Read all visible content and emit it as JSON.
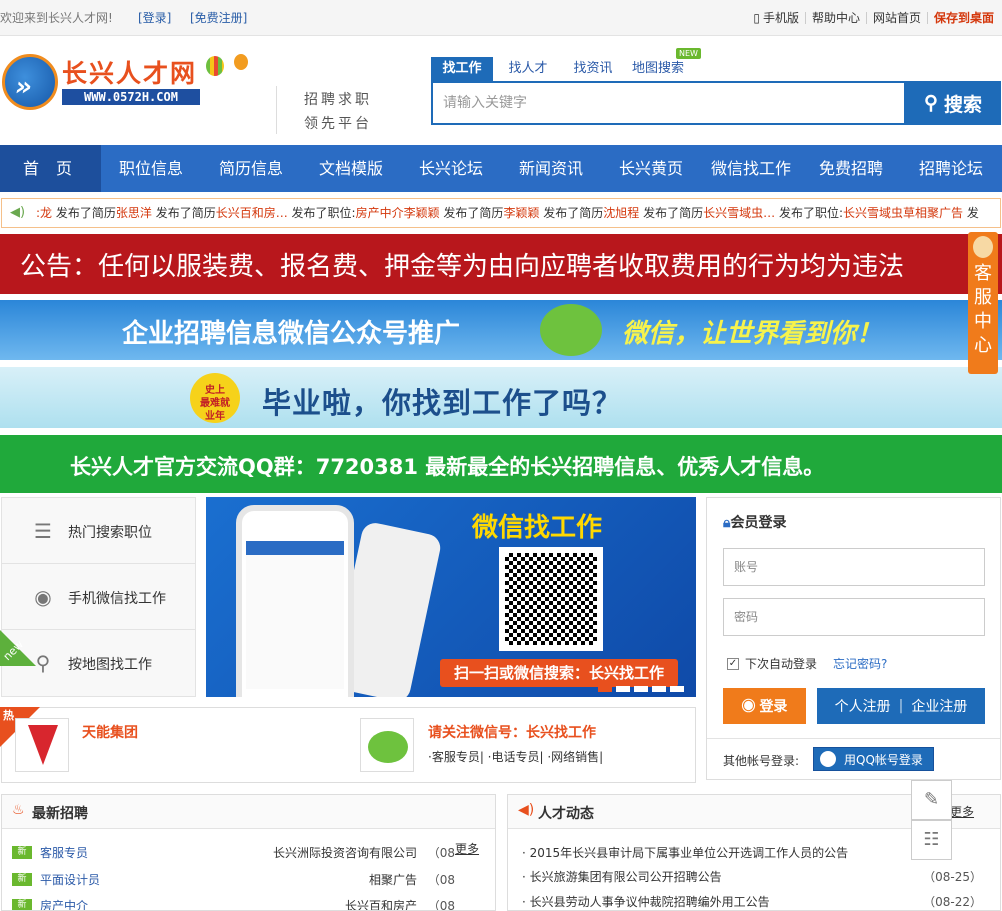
{
  "topbar": {
    "welcome": "欢迎来到长兴人才网!",
    "login": "[登录]",
    "register": "[免费注册]",
    "mobile": "手机版",
    "help": "帮助中心",
    "home": "网站首页",
    "save": "保存到桌面"
  },
  "header": {
    "logo_title": "长兴人才网",
    "logo_url": "WWW.0572H.COM",
    "slogan_line1": "招聘求职",
    "slogan_line2": "领先平台"
  },
  "search": {
    "tabs": [
      "找工作",
      "找人才",
      "找资讯",
      "地图搜索"
    ],
    "new_badge": "NEW",
    "placeholder": "请输入关键字",
    "button": "搜索"
  },
  "nav": [
    "首 页",
    "职位信息",
    "简历信息",
    "文档模版",
    "长兴论坛",
    "新闻资讯",
    "长兴黄页",
    "微信找工作",
    "免费招聘",
    "招聘论坛"
  ],
  "ticker": {
    "segments": [
      {
        "text": ":龙",
        "hl": true
      },
      {
        "text": " 发布了简历",
        "hl": false
      },
      {
        "text": "张思洋",
        "hl": true
      },
      {
        "text": " 发布了简历",
        "hl": false
      },
      {
        "text": "长兴百和房…",
        "hl": true
      },
      {
        "text": " 发布了职位:",
        "hl": false
      },
      {
        "text": "房产中介李颖颖",
        "hl": true
      },
      {
        "text": " 发布了简历",
        "hl": false
      },
      {
        "text": "李颖颖",
        "hl": true
      },
      {
        "text": " 发布了简历",
        "hl": false
      },
      {
        "text": "沈旭程",
        "hl": true
      },
      {
        "text": " 发布了简历",
        "hl": false
      },
      {
        "text": "长兴雪域虫…",
        "hl": true
      },
      {
        "text": " 发布了职位:",
        "hl": false
      },
      {
        "text": "长兴雪域虫草相聚广告",
        "hl": true
      },
      {
        "text": " 发",
        "hl": false
      }
    ]
  },
  "banners": {
    "notice": "公告：任何以服装费、报名费、押金等为由向应聘者收取费用的行为均为违法",
    "wechat_promo": "企业招聘信息微信公众号推广",
    "wechat_slogan": "微信，让世界看到你！",
    "grad_badge_1": "史上",
    "grad_badge_2": "最难就",
    "grad_badge_3": "业年",
    "graduation": "毕业啦，你找到工作了吗？",
    "qq_group": "长兴人才官方交流QQ群：7720381  最新最全的长兴招聘信息、优秀人才信息。"
  },
  "left_menu": [
    {
      "label": "热门搜索职位",
      "icon": "database-search-icon"
    },
    {
      "label": "手机微信找工作",
      "icon": "wechat-icon"
    },
    {
      "label": "按地图找工作",
      "icon": "map-pin-icon"
    }
  ],
  "left_menu_new": "new",
  "promo": {
    "title": "微信找工作",
    "cta": "扫一扫或微信搜索：长兴找工作"
  },
  "login": {
    "title": "会员登录",
    "username_placeholder": "账号",
    "password_placeholder": "密码",
    "auto_login": "下次自动登录",
    "forgot": "忘记密码?",
    "login_btn": "登录",
    "personal_reg": "个人注册",
    "company_reg": "企业注册",
    "other_login": "其他帐号登录:",
    "qq_login": "用QQ帐号登录"
  },
  "hot": {
    "corner": "热",
    "company": "天能集团",
    "wechat_title": "请关注微信号：长兴找工作",
    "wechat_links": "·客服专员| ·电话专员| ·网络销售|"
  },
  "recruit": {
    "title": "最新招聘",
    "more": "更多",
    "rows": [
      {
        "tag": "新",
        "position": "客服专员",
        "company": "长兴洲际投资咨询有限公司",
        "date": "（08"
      },
      {
        "tag": "新",
        "position": "平面设计员",
        "company": "相聚广告",
        "date": "（08"
      },
      {
        "tag": "新",
        "position": "房产中介",
        "company": "长兴百和房产",
        "date": "（08"
      }
    ]
  },
  "news": {
    "title": "人才动态",
    "more": "更多",
    "rows": [
      {
        "title": "· 2015年长兴县审计局下属事业单位公开选调工作人员的公告",
        "date": ""
      },
      {
        "title": "· 长兴旅游集团有限公司公开招聘公告",
        "date": "（08-25）"
      },
      {
        "title": "· 长兴县劳动人事争议仲裁院招聘编外用工公告",
        "date": "（08-22）"
      }
    ]
  },
  "kefu": "客服中心"
}
